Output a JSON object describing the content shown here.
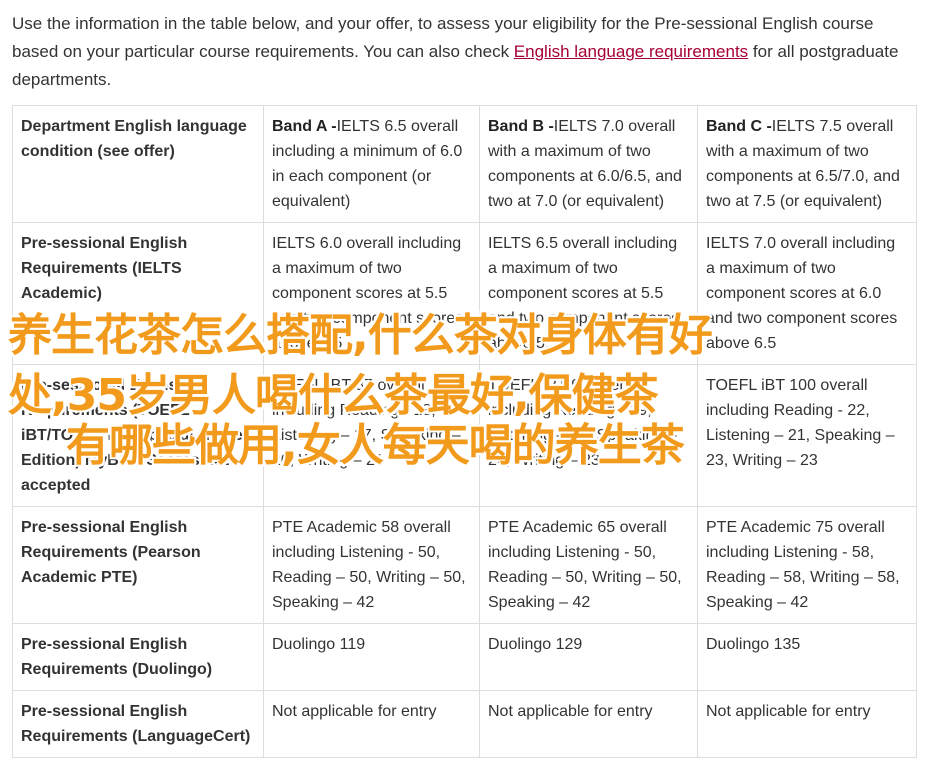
{
  "intro": {
    "text_before": "Use the information in the table below, and your offer, to assess your eligibility for the Pre-sessional English course based on your particular course requirements. You can also check ",
    "link": "English language requirements",
    "text_after": " for all postgraduate departments."
  },
  "table": {
    "rows": [
      {
        "label": "Department English language condition (see offer)",
        "cells": [
          {
            "band": "Band A -",
            "text": "IELTS 6.5 overall including a minimum of 6.0 in each component (or equivalent)"
          },
          {
            "band": "Band B -",
            "text": "IELTS 7.0 overall with a maximum of two components at 6.0/6.5, and two at 7.0 (or equivalent)"
          },
          {
            "band": "Band C -",
            "text": "IELTS 7.5 overall with a maximum of two components at 6.5/7.0, and two at 7.5 (or equivalent)"
          }
        ]
      },
      {
        "label": "Pre-sessional English Requirements (IELTS Academic)",
        "cells": [
          {
            "text": "IELTS 6.0 overall including a maximum of two component scores at 5.5 and two component scores above 5.5"
          },
          {
            "text": "IELTS 6.5 overall including a maximum of two component scores at 5.5 and two component scores above 5.5"
          },
          {
            "text": "IELTS 7.0 overall including a maximum of two component scores at 6.0 and two component scores above 6.5"
          }
        ]
      },
      {
        "label": "Pre-sessional English Requirements (TOEFL iBT/TOEFL iBT Special Home Edition) MyBest Scores not accepted",
        "cells": [
          {
            "text": "TOEFL iBT 87 overall including Reading - 18, Listening – 17, Speaking – 20, Writing – 21"
          },
          {
            "text": "TOEFL iBT 92 overall including Reading - 19, Listening – 19, Speaking – 20, Writing – 23"
          },
          {
            "text": "TOEFL iBT 100 overall including Reading - 22, Listening – 21, Speaking – 23, Writing – 23"
          }
        ]
      },
      {
        "label": "Pre-sessional English Requirements (Pearson Academic PTE)",
        "cells": [
          {
            "text": "PTE Academic 58 overall including Listening - 50, Reading – 50, Writing – 50, Speaking – 42"
          },
          {
            "text": "PTE Academic 65 overall including Listening - 50, Reading – 50, Writing – 50, Speaking – 42"
          },
          {
            "text": "PTE Academic 75 overall including Listening - 58, Reading – 58, Writing – 58, Speaking – 42"
          }
        ]
      },
      {
        "label": "Pre-sessional English Requirements (Duolingo)",
        "cells": [
          {
            "text": "Duolingo 119"
          },
          {
            "text": "Duolingo 129"
          },
          {
            "text": "Duolingo 135"
          }
        ]
      },
      {
        "label": "Pre-sessional English Requirements (LanguageCert)",
        "cells": [
          {
            "text": "Not applicable for entry"
          },
          {
            "text": "Not applicable for entry"
          },
          {
            "text": "Not applicable for entry"
          }
        ]
      }
    ]
  },
  "overlay": {
    "line1": "养生花茶怎么搭配,什么茶对身体有好",
    "line2": "处,35岁男人喝什么茶最好,保健茶",
    "line3": "有哪些做用,女人每天喝的养生茶"
  },
  "colors": {
    "link": "#a50034",
    "overlay": "#f29a1c",
    "border": "#dddddd"
  }
}
